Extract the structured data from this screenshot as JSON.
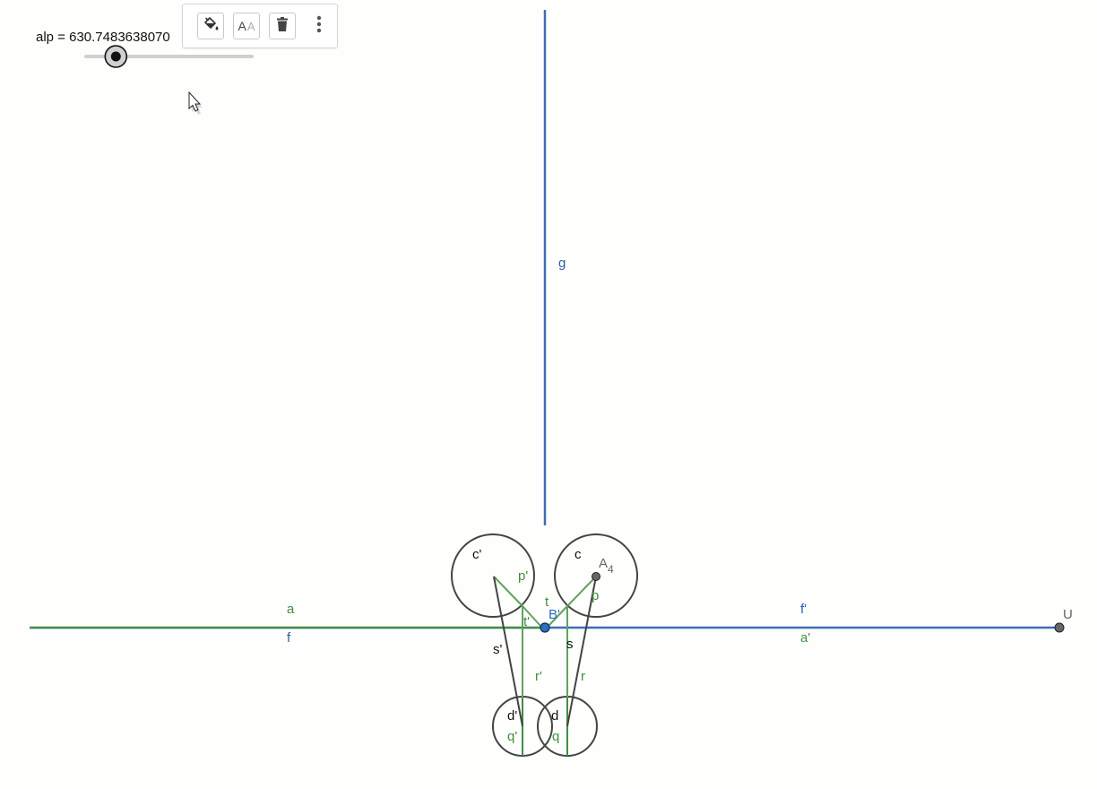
{
  "slider": {
    "label": "alp = 630.7483638070",
    "value_fraction": 0.18
  },
  "toolbar": {
    "color_icon": "paint-bucket-icon",
    "style_icon": "text-style-icon",
    "style_text_large": "A",
    "style_text_small": "A",
    "delete_icon": "trash-icon",
    "more_icon": "more-vertical-icon"
  },
  "colors": {
    "blue": "#3d6fb5",
    "green": "#3f8f3f",
    "green_light": "#5fa35f",
    "dark": "#444444",
    "background": "#fefefc"
  },
  "labels": {
    "g": "g",
    "a": "a",
    "f": "f",
    "f_prime": "f'",
    "a_prime": "a'",
    "U": "U",
    "B_prime": "B'",
    "t": "t",
    "t_prime": "t'",
    "p_prime": "p'",
    "p": "p",
    "c": "c",
    "c_prime": "c'",
    "A": "A",
    "A_sub": "4",
    "s": "s",
    "s_prime": "s'",
    "r": "r",
    "r_prime": "r'",
    "d": "d",
    "d_prime": "d'",
    "q": "q",
    "q_prime": "q'"
  }
}
